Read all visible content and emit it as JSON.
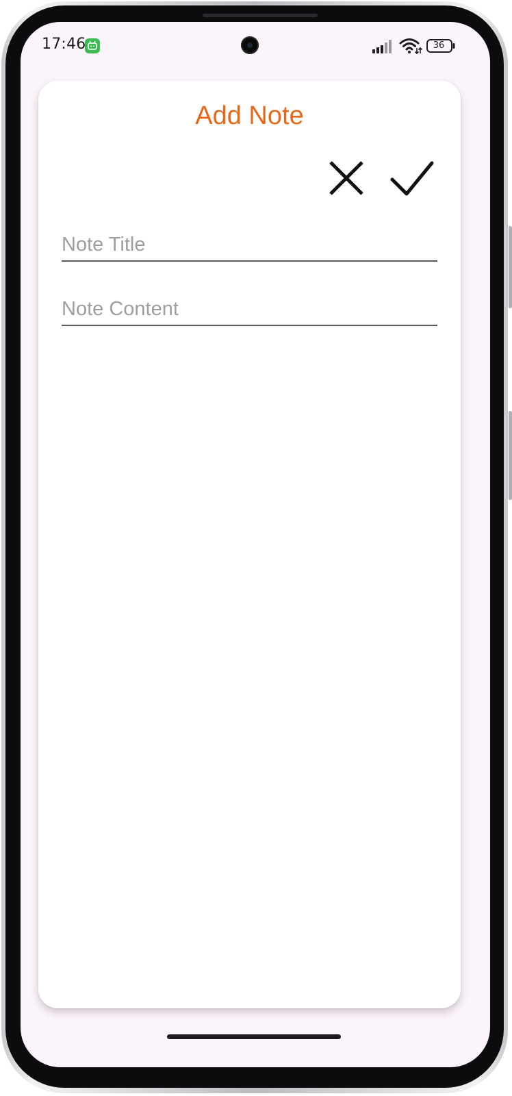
{
  "status_bar": {
    "time": "17:46",
    "battery": "36",
    "icons": [
      "app-notification-icon",
      "signal-icon",
      "wifi-icon",
      "battery-icon"
    ]
  },
  "dialog": {
    "title": "Add Note",
    "title_color": "#e8681a",
    "close_icon": "close-icon",
    "confirm_icon": "check-icon",
    "note_title_placeholder": "Note Title",
    "note_title_value": "",
    "note_content_placeholder": "Note Content",
    "note_content_value": ""
  },
  "colors": {
    "screen_background": "#fcf4fb",
    "card_background": "#ffffff",
    "app_badge": "#3dbb52"
  }
}
